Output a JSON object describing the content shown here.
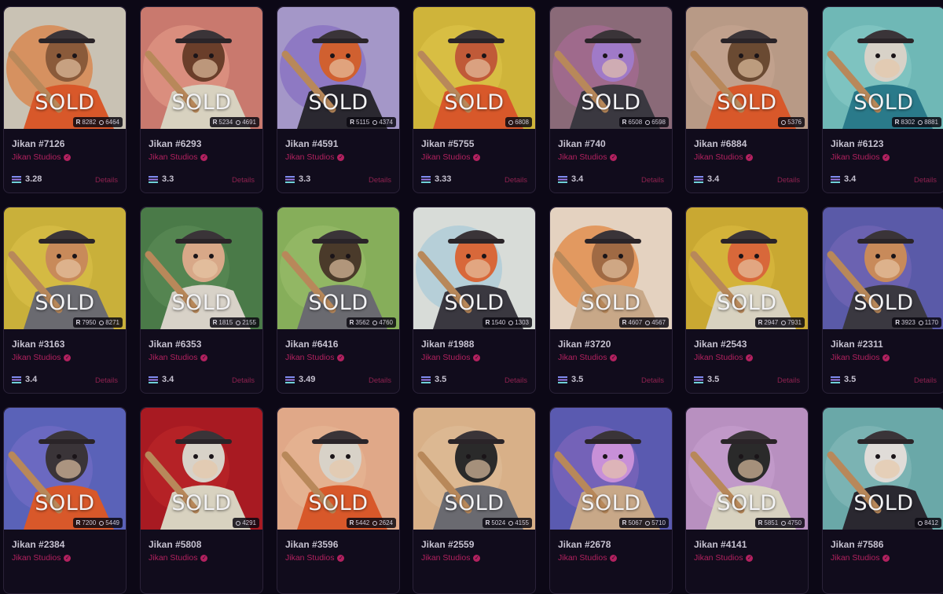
{
  "overlay_label": "SOLD",
  "details_label": "Details",
  "creator_name": "Jikan Studios",
  "colors": {
    "creator": "#b2215f",
    "page_background": "#0c0816"
  },
  "cards": [
    {
      "name": "Jikan #7126",
      "rarity": "8282",
      "owners": "6464",
      "price": "3.28",
      "bg": "#c9c2b4",
      "accent": "#e06a1c",
      "fur": "#8a5a3a",
      "outfit": "#d8582a"
    },
    {
      "name": "Jikan #6293",
      "rarity": "5234",
      "owners": "4691",
      "price": "3.3",
      "bg": "#c9796e",
      "accent": "#e7a08c",
      "fur": "#6a3e2a",
      "outfit": "#d8d2c0"
    },
    {
      "name": "Jikan #4591",
      "rarity": "5115",
      "owners": "4374",
      "price": "3.3",
      "bg": "#a497c8",
      "accent": "#7b60c0",
      "fur": "#d06030",
      "outfit": "#2a2830"
    },
    {
      "name": "Jikan #5755",
      "rarity": "",
      "owners": "6808",
      "price": "3.33",
      "bg": "#cfb43a",
      "accent": "#e0c64a",
      "fur": "#c05a38",
      "outfit": "#d8582a"
    },
    {
      "name": "Jikan #740",
      "rarity": "6508",
      "owners": "6598",
      "price": "3.4",
      "bg": "#8a6a78",
      "accent": "#b06a9c",
      "fur": "#a07ac8",
      "outfit": "#3a3840"
    },
    {
      "name": "Jikan #6884",
      "rarity": "",
      "owners": "5376",
      "price": "3.4",
      "bg": "#b89a86",
      "accent": "#c8a894",
      "fur": "#6a4a32",
      "outfit": "#d8582a"
    },
    {
      "name": "Jikan #6123",
      "rarity": "8302",
      "owners": "8881",
      "price": "3.4",
      "bg": "#6fb8b6",
      "accent": "#8accc8",
      "fur": "#d8d2c8",
      "outfit": "#2a7a8a"
    },
    {
      "name": "Jikan #3163",
      "rarity": "7950",
      "owners": "8271",
      "price": "3.4",
      "bg": "#c9b03a",
      "accent": "#dcc24a",
      "fur": "#c88a5a",
      "outfit": "#6a6a70"
    },
    {
      "name": "Jikan #6353",
      "rarity": "1815",
      "owners": "2155",
      "price": "3.4",
      "bg": "#4a7a48",
      "accent": "#5e8e5a",
      "fur": "#d8a888",
      "outfit": "#d8d2c8"
    },
    {
      "name": "Jikan #6416",
      "rarity": "3562",
      "owners": "4760",
      "price": "3.49",
      "bg": "#86ae5a",
      "accent": "#9cc06e",
      "fur": "#4a3a2a",
      "outfit": "#6a6a70"
    },
    {
      "name": "Jikan #1988",
      "rarity": "1540",
      "owners": "1303",
      "price": "3.5",
      "bg": "#d8dcd8",
      "accent": "#9ac4d8",
      "fur": "#d8683a",
      "outfit": "#3a3840"
    },
    {
      "name": "Jikan #3720",
      "rarity": "4607",
      "owners": "4567",
      "price": "3.5",
      "bg": "#e4d2c0",
      "accent": "#e06a10",
      "fur": "#a06a44",
      "outfit": "#c8a888"
    },
    {
      "name": "Jikan #2543",
      "rarity": "2947",
      "owners": "7931",
      "price": "3.5",
      "bg": "#c9a832",
      "accent": "#dcbc42",
      "fur": "#d8683a",
      "outfit": "#d8d2c0"
    },
    {
      "name": "Jikan #2311",
      "rarity": "3923",
      "owners": "1170",
      "price": "3.5",
      "bg": "#5a5aa8",
      "accent": "#7a6ab8",
      "fur": "#c88a5a",
      "outfit": "#3a3840"
    },
    {
      "name": "Jikan #2384",
      "rarity": "7200",
      "owners": "5449",
      "price": "",
      "bg": "#5a62b8",
      "accent": "#7a70c8",
      "fur": "#3a3438",
      "outfit": "#d8582a"
    },
    {
      "name": "Jikan #5808",
      "rarity": "",
      "owners": "4291",
      "price": "",
      "bg": "#a81a22",
      "accent": "#c02a2a",
      "fur": "#d8d2c8",
      "outfit": "#d8d2c0"
    },
    {
      "name": "Jikan #3596",
      "rarity": "5442",
      "owners": "2624",
      "price": "",
      "bg": "#e0a888",
      "accent": "#e8b898",
      "fur": "#d8d2c8",
      "outfit": "#d8582a"
    },
    {
      "name": "Jikan #2559",
      "rarity": "5024",
      "owners": "4155",
      "price": "",
      "bg": "#d8b088",
      "accent": "#e0c09a",
      "fur": "#2a2a2a",
      "outfit": "#6a6a70"
    },
    {
      "name": "Jikan #2678",
      "rarity": "5067",
      "owners": "5710",
      "price": "",
      "bg": "#5a5ab0",
      "accent": "#8a6ac0",
      "fur": "#c890d8",
      "outfit": "#c8a888"
    },
    {
      "name": "Jikan #4141",
      "rarity": "5851",
      "owners": "4750",
      "price": "",
      "bg": "#b890c0",
      "accent": "#c8a0d0",
      "fur": "#2a2a2a",
      "outfit": "#d8d2c0"
    },
    {
      "name": "Jikan #7586",
      "rarity": "",
      "owners": "8412",
      "price": "",
      "bg": "#6aa8a8",
      "accent": "#88bcbc",
      "fur": "#e0dcd8",
      "outfit": "#2a2830"
    }
  ]
}
